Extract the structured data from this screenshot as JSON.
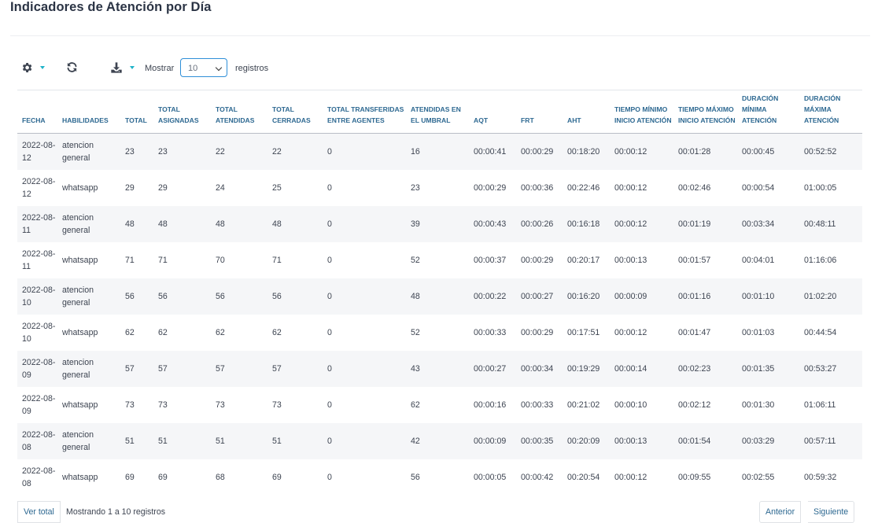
{
  "page": {
    "title": "Indicadores de Atención por Día"
  },
  "toolbar": {
    "settings_icon": "gear-icon",
    "refresh_icon": "refresh-icon",
    "download_icon": "download-icon",
    "show_label": "Mostrar",
    "page_size": "10",
    "records_label": "registros",
    "accent_color": "#1fb3c9"
  },
  "table": {
    "columns": [
      "FECHA",
      "HABILIDADES",
      "TOTAL",
      "TOTAL ASIGNADAS",
      "TOTAL ATENDIDAS",
      "TOTAL CERRADAS",
      "TOTAL TRANSFERIDAS ENTRE AGENTES",
      "ATENDIDAS EN EL UMBRAL",
      "AQT",
      "FRT",
      "AHT",
      "TIEMPO MÍNIMO INICIO ATENCIÓN",
      "TIEMPO MÁXIMO INICIO ATENCIÓN",
      "DURACIÓN MÍNIMA ATENCIÓN",
      "DURACIÓN MÁXIMA ATENCIÓN"
    ],
    "rows": [
      [
        "2022-08-12",
        "atencion general",
        "23",
        "23",
        "22",
        "22",
        "0",
        "16",
        "00:00:41",
        "00:00:29",
        "00:18:20",
        "00:00:12",
        "00:01:28",
        "00:00:45",
        "00:52:52"
      ],
      [
        "2022-08-12",
        "whatsapp",
        "29",
        "29",
        "24",
        "25",
        "0",
        "23",
        "00:00:29",
        "00:00:36",
        "00:22:46",
        "00:00:12",
        "00:02:46",
        "00:00:54",
        "01:00:05"
      ],
      [
        "2022-08-11",
        "atencion general",
        "48",
        "48",
        "48",
        "48",
        "0",
        "39",
        "00:00:43",
        "00:00:26",
        "00:16:18",
        "00:00:12",
        "00:01:19",
        "00:03:34",
        "00:48:11"
      ],
      [
        "2022-08-11",
        "whatsapp",
        "71",
        "71",
        "70",
        "71",
        "0",
        "52",
        "00:00:37",
        "00:00:29",
        "00:20:17",
        "00:00:13",
        "00:01:57",
        "00:04:01",
        "01:16:06"
      ],
      [
        "2022-08-10",
        "atencion general",
        "56",
        "56",
        "56",
        "56",
        "0",
        "48",
        "00:00:22",
        "00:00:27",
        "00:16:20",
        "00:00:09",
        "00:01:16",
        "00:01:10",
        "01:02:20"
      ],
      [
        "2022-08-10",
        "whatsapp",
        "62",
        "62",
        "62",
        "62",
        "0",
        "52",
        "00:00:33",
        "00:00:29",
        "00:17:51",
        "00:00:12",
        "00:01:47",
        "00:01:03",
        "00:44:54"
      ],
      [
        "2022-08-09",
        "atencion general",
        "57",
        "57",
        "57",
        "57",
        "0",
        "43",
        "00:00:27",
        "00:00:34",
        "00:19:29",
        "00:00:14",
        "00:02:23",
        "00:01:35",
        "00:53:27"
      ],
      [
        "2022-08-09",
        "whatsapp",
        "73",
        "73",
        "73",
        "73",
        "0",
        "62",
        "00:00:16",
        "00:00:33",
        "00:21:02",
        "00:00:10",
        "00:02:12",
        "00:01:30",
        "01:06:11"
      ],
      [
        "2022-08-08",
        "atencion general",
        "51",
        "51",
        "51",
        "51",
        "0",
        "42",
        "00:00:09",
        "00:00:35",
        "00:20:09",
        "00:00:13",
        "00:01:54",
        "00:03:29",
        "00:57:11"
      ],
      [
        "2022-08-08",
        "whatsapp",
        "69",
        "69",
        "68",
        "69",
        "0",
        "56",
        "00:00:05",
        "00:00:42",
        "00:20:54",
        "00:00:12",
        "00:09:55",
        "00:02:55",
        "00:59:32"
      ]
    ]
  },
  "footer": {
    "view_total_label": "Ver total",
    "info": "Mostrando 1 a 10 registros",
    "prev_label": "Anterior",
    "next_label": "Siguiente"
  }
}
